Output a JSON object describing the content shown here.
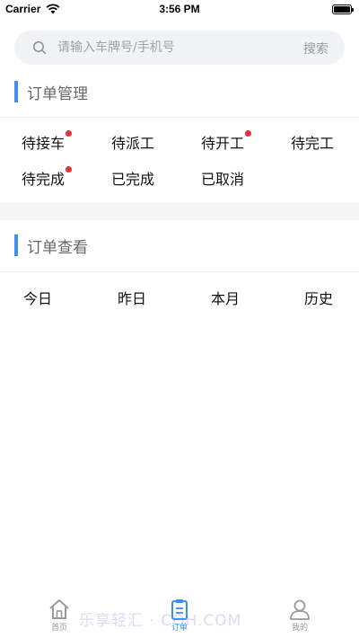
{
  "status_bar": {
    "carrier": "Carrier",
    "time": "3:56 PM"
  },
  "search": {
    "placeholder": "请输入车牌号/手机号",
    "button_label": "搜索"
  },
  "order_management": {
    "title": "订单管理",
    "items": [
      {
        "label": "待接车",
        "has_dot": true
      },
      {
        "label": "待派工",
        "has_dot": false
      },
      {
        "label": "待开工",
        "has_dot": true
      },
      {
        "label": "待完工",
        "has_dot": false
      },
      {
        "label": "待完成",
        "has_dot": true
      },
      {
        "label": "已完成",
        "has_dot": false
      },
      {
        "label": "已取消",
        "has_dot": false
      }
    ]
  },
  "order_view": {
    "title": "订单查看",
    "items": [
      "今日",
      "昨日",
      "本月",
      "历史"
    ]
  },
  "tab_bar": {
    "tabs": [
      {
        "label": "首页",
        "icon": "home-icon",
        "active": false
      },
      {
        "label": "订单",
        "icon": "clipboard-icon",
        "active": true
      },
      {
        "label": "我的",
        "icon": "person-icon",
        "active": false
      }
    ]
  },
  "watermark": "乐享轻汇 · CQH.COM",
  "colors": {
    "accent": "#3a8ff0",
    "dot": "#f02b3c",
    "search_bg": "#f1f2f5"
  }
}
